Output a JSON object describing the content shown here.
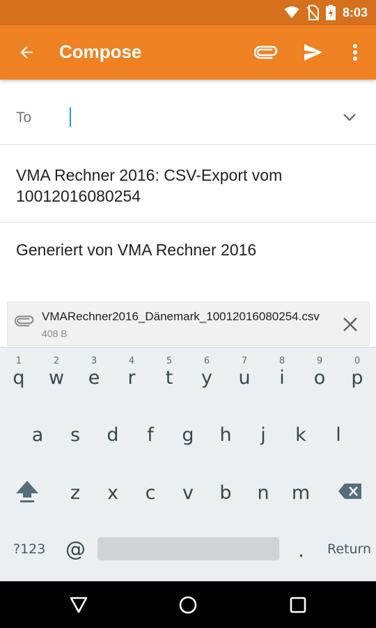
{
  "status_bar": {
    "time": "8:03",
    "icons": [
      "wifi-icon",
      "no-sim-icon",
      "battery-charging-icon"
    ]
  },
  "app_bar": {
    "title": "Compose",
    "icons": [
      "arrow-back-icon",
      "attach-icon",
      "send-icon",
      "more-vert-icon"
    ],
    "color": "#ee8121"
  },
  "compose": {
    "to_label": "To",
    "to_value": "",
    "subject": "VMA Rechner 2016: CSV-Export vom 10012016080254",
    "body": "Generiert von VMA Rechner 2016"
  },
  "attachment": {
    "name": "VMARechner2016_Dänemark_10012016080254.csv",
    "size": "408 B"
  },
  "keyboard": {
    "row1": [
      {
        "ch": "q",
        "hint": "1"
      },
      {
        "ch": "w",
        "hint": "2"
      },
      {
        "ch": "e",
        "hint": "3"
      },
      {
        "ch": "r",
        "hint": "4"
      },
      {
        "ch": "t",
        "hint": "5"
      },
      {
        "ch": "y",
        "hint": "6"
      },
      {
        "ch": "u",
        "hint": "7"
      },
      {
        "ch": "i",
        "hint": "8"
      },
      {
        "ch": "o",
        "hint": "9"
      },
      {
        "ch": "p",
        "hint": "0"
      }
    ],
    "row2": [
      "a",
      "s",
      "d",
      "f",
      "g",
      "h",
      "j",
      "k",
      "l"
    ],
    "row3": [
      "z",
      "x",
      "c",
      "v",
      "b",
      "n",
      "m"
    ],
    "symbols_label": "?123",
    "at_label": "@",
    "period_label": ".",
    "return_label": "Return"
  },
  "nav_bar": {
    "icons": [
      "back-triangle-icon",
      "home-circle-icon",
      "recents-square-icon"
    ]
  }
}
